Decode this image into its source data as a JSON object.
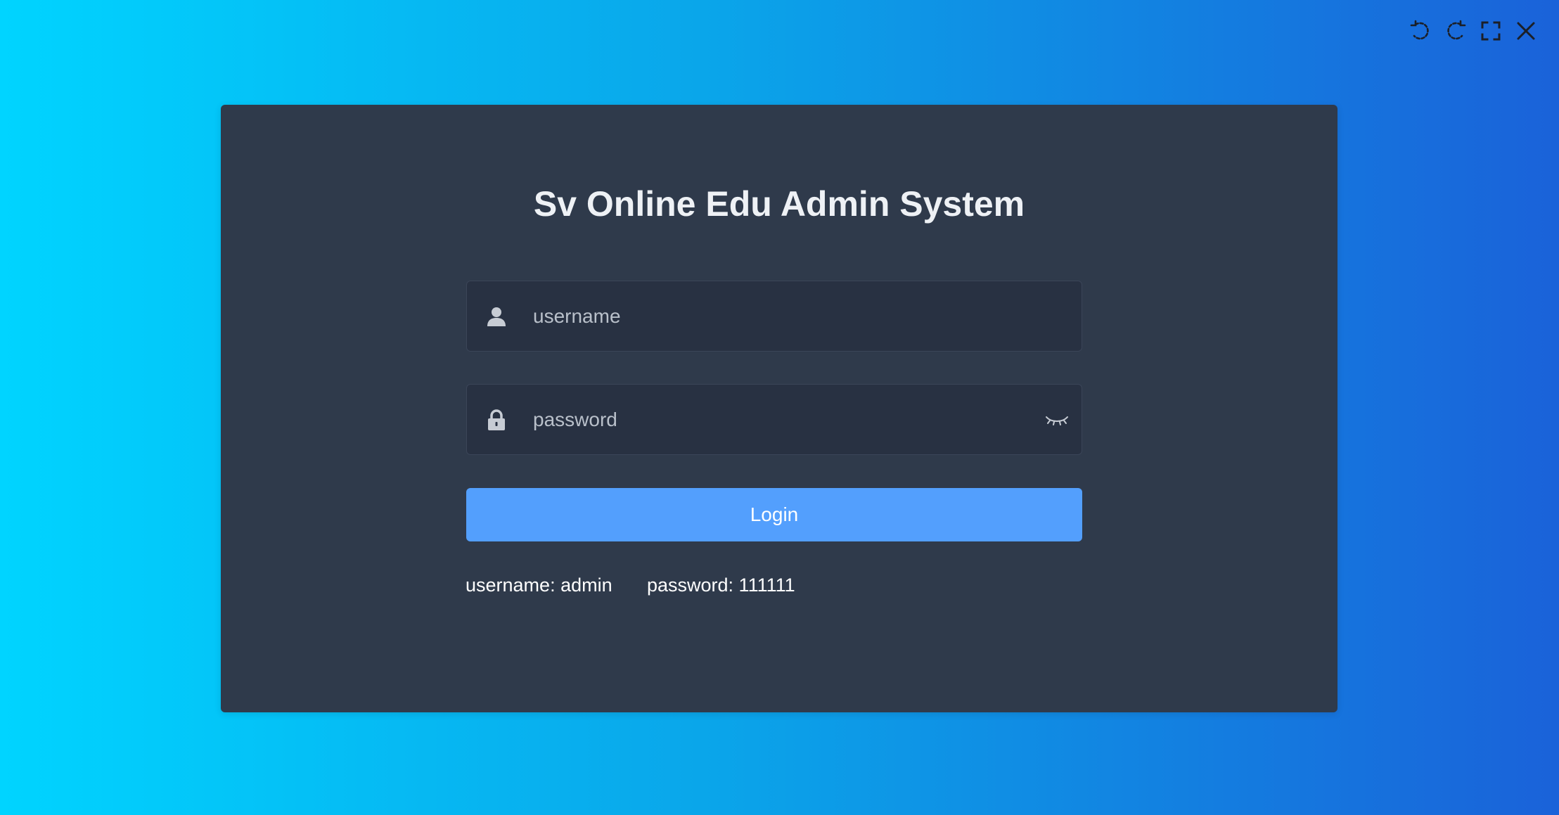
{
  "toolbar": {
    "icons": [
      "rotate-left-icon",
      "rotate-right-icon",
      "fullscreen-icon",
      "close-icon"
    ]
  },
  "login": {
    "title": "Sv Online Edu Admin System",
    "username_placeholder": "username",
    "password_placeholder": "password",
    "login_label": "Login",
    "hint_username": "username: admin",
    "hint_password": "password: 111111"
  },
  "colors": {
    "background_gradient": [
      "#00d4ff",
      "#1a62d9"
    ],
    "card": "#2f3a4b",
    "input": "#283142",
    "primary": "#539ffd"
  }
}
